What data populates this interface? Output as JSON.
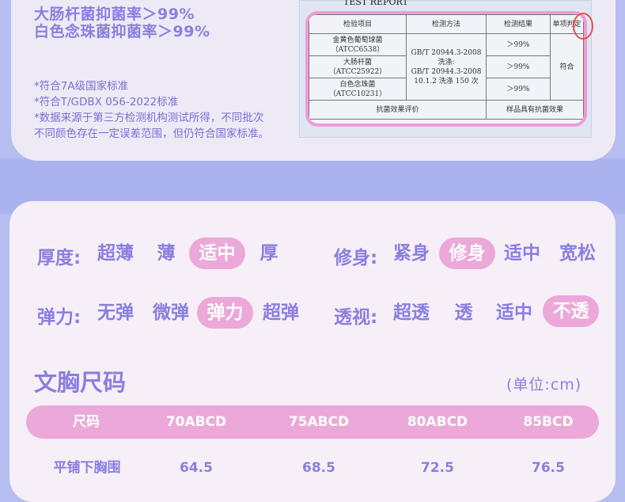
{
  "top": {
    "claims": [
      "大肠杆菌抑菌率＞99%",
      "白色念珠菌抑菌率＞99%"
    ],
    "notes": [
      "*符合7A级国家标准",
      "*符合T/GDBX 056-2022标准",
      "*数据来源于第三方检测机构测试所得，不同批次",
      "不同颜色存在一定误差范围，但仍符合国家标准。"
    ]
  },
  "report": {
    "title": "TEST REPORT",
    "headers": [
      "检验项目",
      "检测方法",
      "检测结果",
      "单项判定"
    ],
    "rows": [
      {
        "item": "金黄色葡萄球菌",
        "code": "（ATCC6538）",
        "result": "＞99%"
      },
      {
        "item": "大肠杆菌",
        "code": "（ATCC25922）",
        "result": "＞99%"
      },
      {
        "item": "白色念珠菌",
        "code": "（ATCC10231）",
        "result": "＞99%"
      }
    ],
    "method": [
      "GB/T 20944.3-2008",
      "洗涤:",
      "GB/T 20944.3-2008",
      "10.1.2 洗涤 150 次"
    ],
    "verdict": "符合",
    "footer_left": "抗菌效果评价",
    "footer_right": "样品具有抗菌效果"
  },
  "attributes": [
    {
      "label": "厚度:",
      "options": [
        "超薄",
        "薄",
        "适中",
        "厚"
      ],
      "selected": 2
    },
    {
      "label": "修身:",
      "options": [
        "紧身",
        "修身",
        "适中",
        "宽松"
      ],
      "selected": 1
    },
    {
      "label": "弹力:",
      "options": [
        "无弹",
        "微弹",
        "弹力",
        "超弹"
      ],
      "selected": 2
    },
    {
      "label": "透视:",
      "options": [
        "超透",
        "透",
        "适中",
        "不透"
      ],
      "selected": 3
    }
  ],
  "size_chart": {
    "title": "文胸尺码",
    "unit": "(单位:cm)",
    "headers": [
      "尺码",
      "70ABCD",
      "75ABCD",
      "80ABCD",
      "85BCD"
    ],
    "rows": [
      {
        "label": "平铺下胸围",
        "values": [
          "64.5",
          "68.5",
          "72.5",
          "76.5"
        ]
      }
    ]
  },
  "colors": {
    "accent": "#8a7fe0",
    "pink": "#eba8d9",
    "background": "#b5bdf1"
  }
}
